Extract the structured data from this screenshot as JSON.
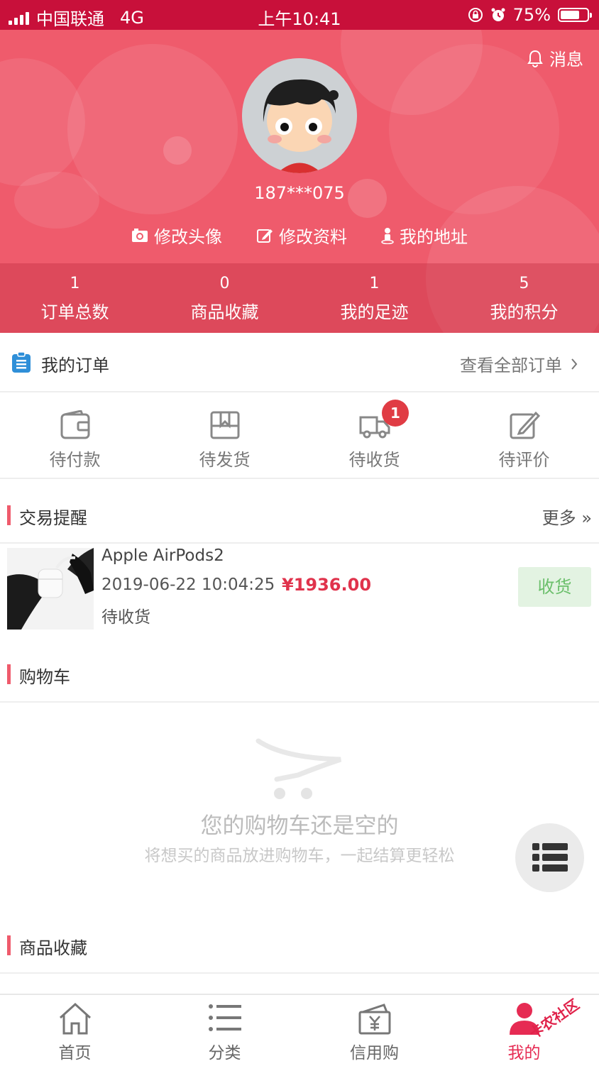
{
  "status_bar": {
    "carrier": "中国联通",
    "network": "4G",
    "time": "上午10:41",
    "battery": "75%"
  },
  "header": {
    "message_label": "消息",
    "phone": "187***075",
    "actions": [
      "修改头像",
      "修改资料",
      "我的地址"
    ],
    "stats": [
      {
        "value": "1",
        "label": "订单总数"
      },
      {
        "value": "0",
        "label": "商品收藏"
      },
      {
        "value": "1",
        "label": "我的足迹"
      },
      {
        "value": "5",
        "label": "我的积分"
      }
    ]
  },
  "orders": {
    "title": "我的订单",
    "view_all": "查看全部订单",
    "icons": [
      {
        "label": "待付款",
        "icon": "wallet-icon"
      },
      {
        "label": "待发货",
        "icon": "package-icon"
      },
      {
        "label": "待收货",
        "icon": "truck-icon",
        "badge": "1"
      },
      {
        "label": "待评价",
        "icon": "edit-icon"
      }
    ]
  },
  "trade": {
    "title": "交易提醒",
    "more": "更多 »",
    "item": {
      "name": "Apple AirPods2",
      "date": "2019-06-22 10:04:25",
      "price": "¥1936.00",
      "status": "待收货",
      "action": "收货"
    }
  },
  "cart": {
    "title": "购物车",
    "empty_title": "您的购物车还是空的",
    "empty_sub": "将想买的商品放进购物车，一起结算更轻松"
  },
  "favorites": {
    "title": "商品收藏"
  },
  "tabbar": {
    "tabs": [
      "首页",
      "分类",
      "信用购",
      "我的"
    ],
    "active_index": 3
  },
  "watermark": "卡农社区",
  "colors": {
    "brand": "#ef5b6c",
    "status_bar": "#c8103a",
    "price": "#e0334c",
    "active_tab": "#e62b53",
    "confirm_button_bg": "#e3f3e2",
    "confirm_button_text": "#6bbf6b"
  }
}
